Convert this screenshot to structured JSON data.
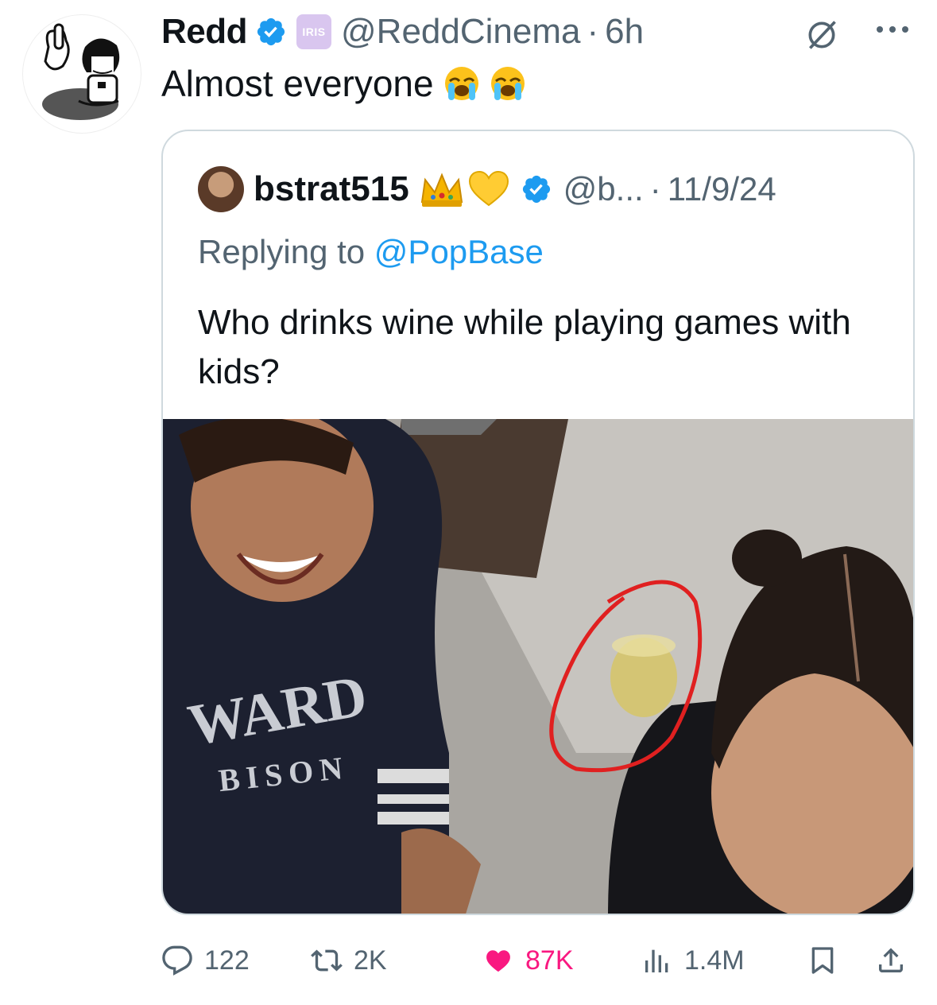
{
  "tweet": {
    "display_name": "Redd",
    "badge_text": "IRIS",
    "handle": "@ReddCinema",
    "separator": "·",
    "time": "6h",
    "text": "Almost everyone",
    "emoji_names": [
      "loudly-crying-face",
      "loudly-crying-face"
    ]
  },
  "quote": {
    "display_name": "bstrat515",
    "name_emojis": [
      "crown",
      "yellow-heart"
    ],
    "handle": "@b...",
    "separator": "·",
    "date": "11/9/24",
    "replying_prefix": "Replying to",
    "replying_mention": "@PopBase",
    "text": "Who drinks wine while playing games with kids?",
    "photo_sweatshirt_text_1": "WARD",
    "photo_sweatshirt_text_2": "BISON"
  },
  "actions": {
    "replies": "122",
    "reposts": "2K",
    "likes": "87K",
    "views": "1.4M"
  },
  "colors": {
    "verified": "#1d9bf0",
    "like": "#f91880",
    "muted": "#536471",
    "circle_annotation": "#e02020"
  }
}
